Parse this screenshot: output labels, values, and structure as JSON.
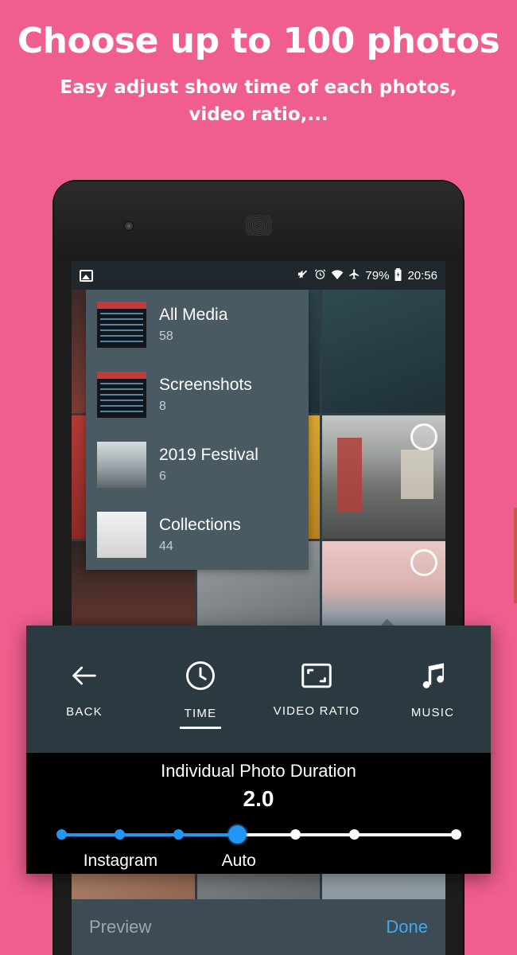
{
  "promo": {
    "title": "Choose up to 100 photos",
    "subtitle": "Easy adjust show time of each photos, video ratio,..."
  },
  "statusbar": {
    "left_icon": "image-icon",
    "icons": [
      "mute-icon",
      "alarm-icon",
      "wifi-icon",
      "airplane-icon"
    ],
    "battery": "79%",
    "battery_icon": "battery-icon",
    "time": "20:56"
  },
  "albums": [
    {
      "name": "All Media",
      "count": "58",
      "thumb": "code-screenshot"
    },
    {
      "name": "Screenshots",
      "count": "8",
      "thumb": "code-screenshot"
    },
    {
      "name": "2019 Festival",
      "count": "6",
      "thumb": "snow-photo"
    },
    {
      "name": "Collections",
      "count": "44",
      "thumb": "white-photo"
    }
  ],
  "gallery": {
    "selection_circles": 3
  },
  "bottombar": {
    "preview": "Preview",
    "done": "Done"
  },
  "panel": {
    "tools": [
      {
        "label": "BACK",
        "icon": "arrow-left-icon",
        "active": false
      },
      {
        "label": "TIME",
        "icon": "clock-icon",
        "active": true
      },
      {
        "label": "VIDEO RATIO",
        "icon": "aspect-ratio-icon",
        "active": false
      },
      {
        "label": "MUSIC",
        "icon": "music-note-icon",
        "active": false
      }
    ],
    "duration": {
      "title": "Individual Photo Duration",
      "value": "2.0",
      "left_label": "Instagram",
      "right_label": "Auto",
      "ticks": 7,
      "selected_tick": 3
    }
  },
  "colors": {
    "background": "#ef5e8c",
    "accent": "#2196f3",
    "panel": "#2b3940",
    "album_panel": "#4a5a63",
    "done_link": "#3fa9f5"
  }
}
